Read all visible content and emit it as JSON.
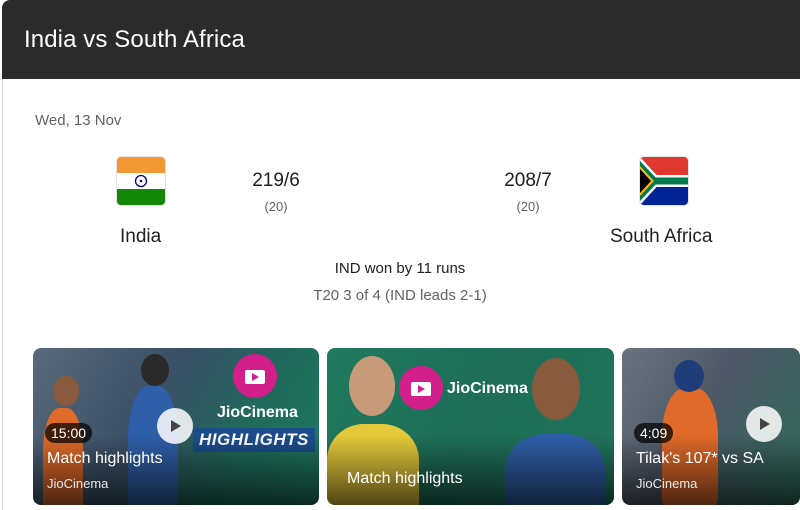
{
  "header": {
    "title": "India vs South Africa"
  },
  "match": {
    "date": "Wed, 13 Nov",
    "team1": {
      "name": "India",
      "score": "219/6",
      "overs": "(20)"
    },
    "team2": {
      "name": "South Africa",
      "score": "208/7",
      "overs": "(20)"
    },
    "result": "IND won by 11 runs",
    "series": "T20 3 of 4 (IND leads 2-1)"
  },
  "videos": [
    {
      "duration": "15:00",
      "title": "Match highlights",
      "source": "JioCinema",
      "brand": "JioCinema",
      "banner": "HIGHLIGHTS"
    },
    {
      "title": "Match highlights",
      "brand": "JioCinema"
    },
    {
      "duration": "4:09",
      "title": "Tilak's 107* vs SA",
      "source": "JioCinema"
    }
  ],
  "colors": {
    "header_bg": "#2b2b2b",
    "jiocinema_pink": "#d21f8c",
    "highlights_blue": "#1b4d8c"
  }
}
